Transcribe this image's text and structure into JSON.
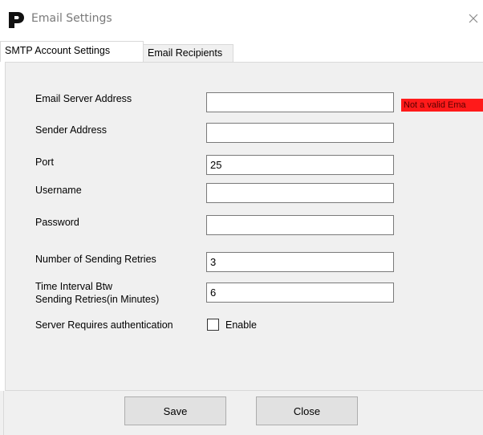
{
  "window": {
    "title": "Email Settings",
    "icon": "app-logo-icon",
    "close_icon": "close-icon"
  },
  "tabs": [
    {
      "label": "SMTP Account Settings",
      "active": true
    },
    {
      "label": "Email Recipients",
      "active": false
    }
  ],
  "form": {
    "server_address": {
      "label": "Email Server Address",
      "value": ""
    },
    "validation_error": "Not a valid Ema",
    "sender_address": {
      "label": "Sender Address",
      "value": ""
    },
    "port": {
      "label": "Port",
      "value": "25"
    },
    "username": {
      "label": "Username",
      "value": ""
    },
    "password": {
      "label": "Password",
      "value": ""
    },
    "retries": {
      "label": "Number of Sending Retries",
      "value": "3"
    },
    "interval": {
      "label_line1": "Time Interval Btw",
      "label_line2": "Sending Retries(in Minutes)",
      "value": "6"
    },
    "auth": {
      "label": "Server Requires authentication",
      "checkbox_label": "Enable",
      "checked": false
    }
  },
  "buttons": {
    "save": "Save",
    "close": "Close"
  },
  "colors": {
    "error_bg": "#ff1a1a",
    "panel_bg": "#f0f0f0",
    "button_bg": "#e1e1e1"
  }
}
